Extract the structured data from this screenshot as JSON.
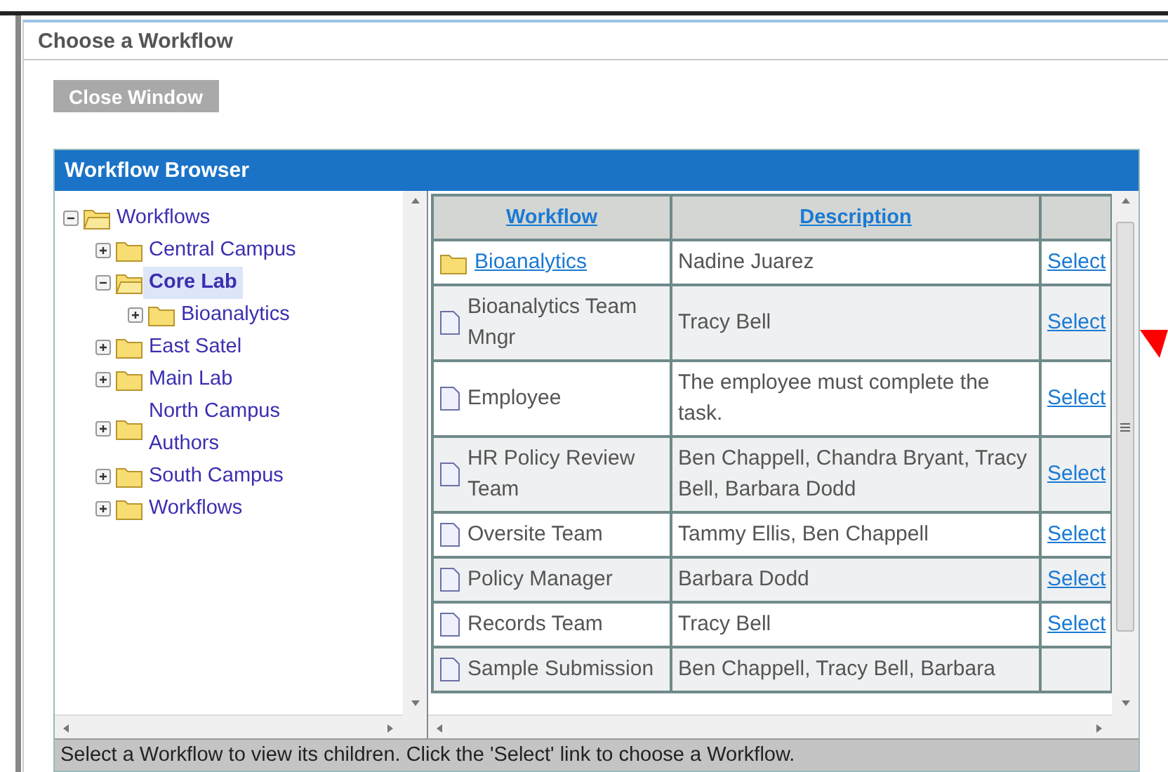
{
  "window": {
    "title": "Choose a Workflow"
  },
  "close_button": {
    "label": "Close Window",
    "disabled": true
  },
  "panel": {
    "title": "Workflow Browser"
  },
  "tree": [
    {
      "label": "Workflows",
      "expanded": true,
      "selected": false,
      "children": [
        {
          "label": "Central Campus",
          "expanded": false,
          "selected": false
        },
        {
          "label": "Core Lab",
          "expanded": true,
          "selected": true,
          "children": [
            {
              "label": "Bioanalytics",
              "expanded": false,
              "selected": false
            }
          ]
        },
        {
          "label": "East Satel",
          "expanded": false,
          "selected": false
        },
        {
          "label": "Main Lab",
          "expanded": false,
          "selected": false
        },
        {
          "label": "North Campus Authors",
          "expanded": false,
          "selected": false
        },
        {
          "label": "South Campus",
          "expanded": false,
          "selected": false
        },
        {
          "label": "Workflows",
          "expanded": false,
          "selected": false
        }
      ]
    }
  ],
  "table": {
    "columns": [
      "Workflow",
      "Description"
    ],
    "rows": [
      {
        "kind": "folder",
        "workflow": "Bioanalytics",
        "description": "Nadine Juarez",
        "action": "Select"
      },
      {
        "kind": "document",
        "workflow": "Bioanalytics Team Mngr",
        "description": "Tracy Bell",
        "action": "Select"
      },
      {
        "kind": "document",
        "workflow": "Employee",
        "description": "The employee must complete the task.",
        "action": "Select"
      },
      {
        "kind": "document",
        "workflow": "HR Policy Review Team",
        "description": "Ben Chappell, Chandra Bryant, Tracy Bell, Barbara Dodd",
        "action": "Select"
      },
      {
        "kind": "document",
        "workflow": "Oversite Team",
        "description": "Tammy Ellis, Ben Chappell",
        "action": "Select"
      },
      {
        "kind": "document",
        "workflow": "Policy Manager",
        "description": "Barbara Dodd",
        "action": "Select"
      },
      {
        "kind": "document",
        "workflow": "Records Team",
        "description": "Tracy Bell",
        "action": "Select"
      },
      {
        "kind": "document",
        "workflow": "Sample Submission",
        "description": "Ben Chappell, Tracy Bell, Barbara"
      }
    ]
  },
  "status_bar": "Select a Workflow to view its children. Click the 'Select' link to choose a Workflow."
}
